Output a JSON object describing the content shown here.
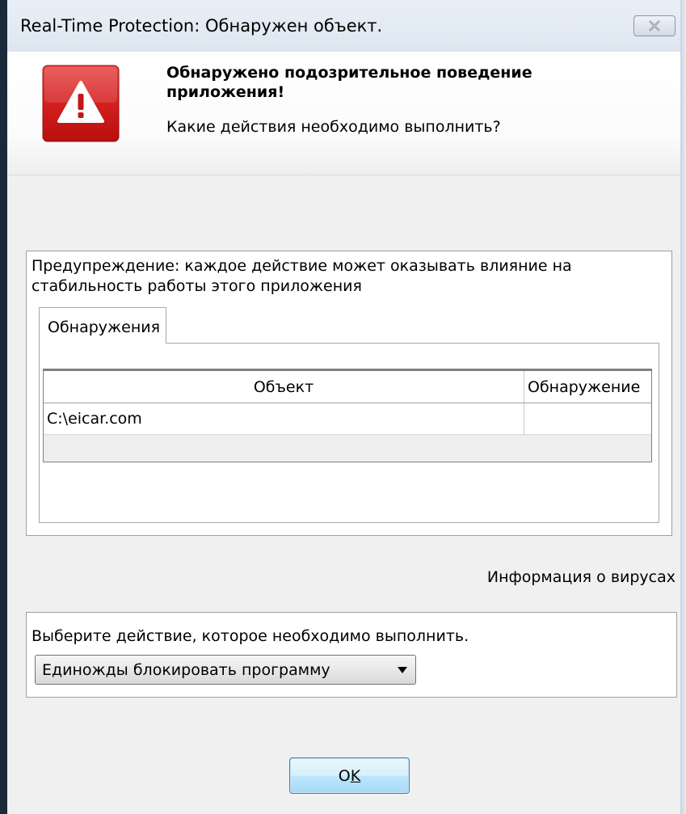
{
  "window": {
    "title": "Real-Time Protection: Обнаружен объект."
  },
  "header": {
    "alert_title": "Обнаружено подозрительное поведение приложения!",
    "question": "Какие действия необходимо выполнить?",
    "icon": "warning-triangle-icon",
    "icon_color": "#d41f1f"
  },
  "warning": {
    "text": "Предупреждение: каждое действие может оказывать влияние на стабильность работы этого приложения"
  },
  "tabs": [
    {
      "label": "Обнаружения"
    }
  ],
  "table": {
    "columns": [
      "Объект",
      "Обнаружение"
    ],
    "rows": [
      {
        "object": "C:\\eicar.com",
        "detection": ""
      }
    ]
  },
  "virus_info_link": "Информация о вирусах",
  "action": {
    "label": "Выберите действие, которое необходимо выполнить.",
    "selected": "Единожды блокировать программу"
  },
  "buttons": {
    "ok_prefix": "O",
    "ok_mnemonic": "K",
    "close_icon": "close-icon"
  }
}
